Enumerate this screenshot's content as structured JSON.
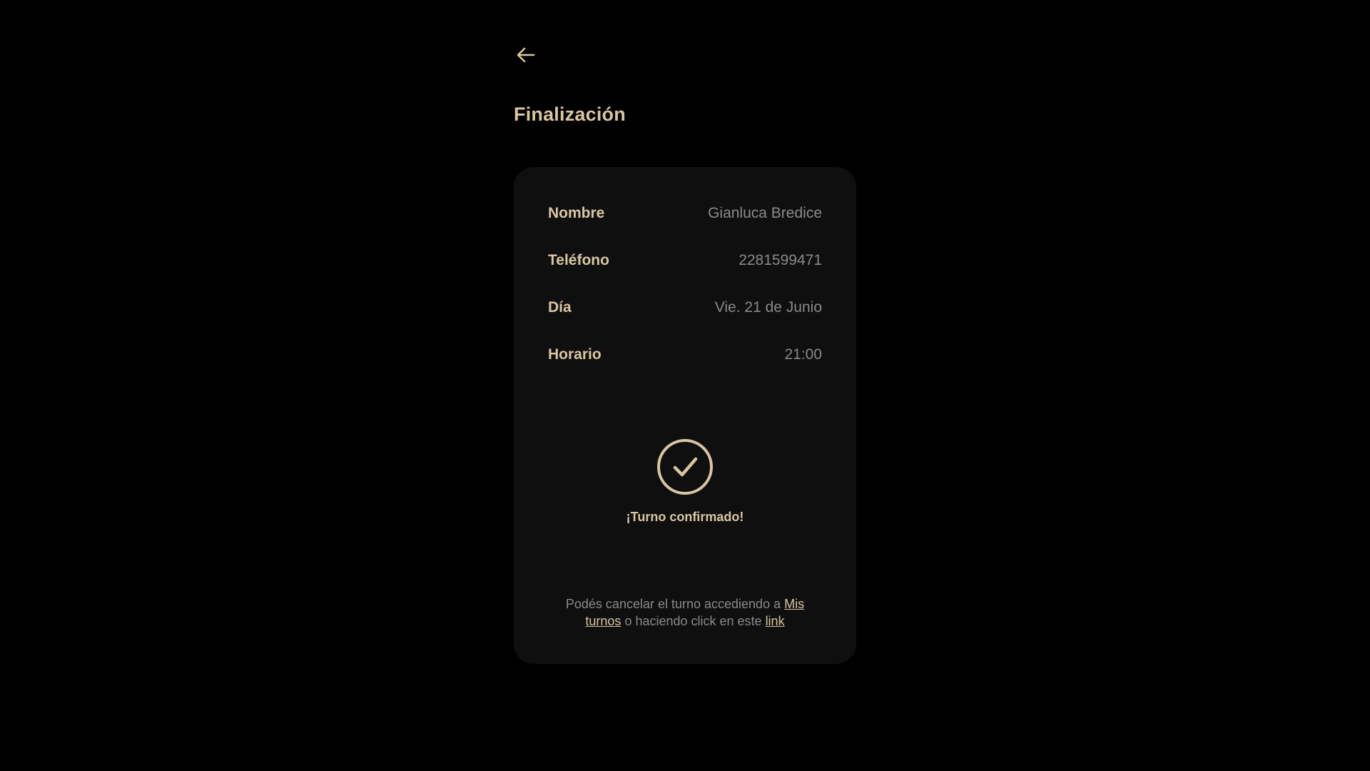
{
  "header": {
    "back_icon": "arrow-left-icon",
    "title": "Finalización"
  },
  "details": [
    {
      "label": "Nombre",
      "value": "Gianluca Bredice"
    },
    {
      "label": "Teléfono",
      "value": "2281599471"
    },
    {
      "label": "Día",
      "value": "Vie. 21 de Junio"
    },
    {
      "label": "Horario",
      "value": "21:00"
    }
  ],
  "confirmation": {
    "icon": "check-circle-icon",
    "message": "¡Turno confirmado!"
  },
  "cancel_note": {
    "text_before": "Podés cancelar el turno accediendo a ",
    "link1_label": "Mis turnos",
    "text_middle": " o haciendo click en este ",
    "link2_label": "link"
  },
  "colors": {
    "background": "#000000",
    "card": "#0f0f0f",
    "accent": "#d9c5a3",
    "muted_text": "#8a8a8a"
  }
}
